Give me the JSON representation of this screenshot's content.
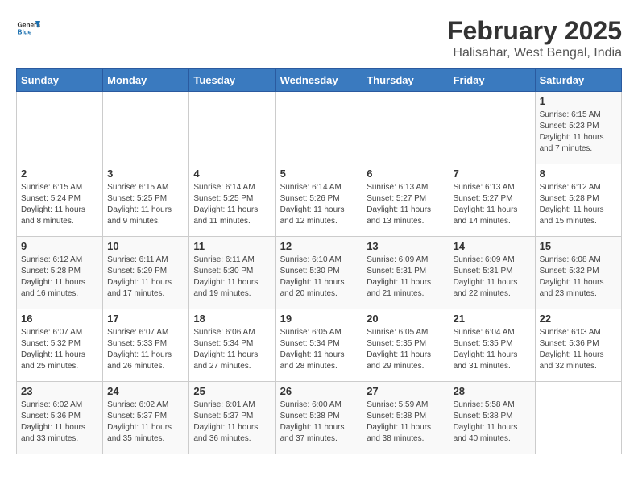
{
  "logo": {
    "text_general": "General",
    "text_blue": "Blue"
  },
  "title": {
    "month": "February 2025",
    "location": "Halisahar, West Bengal, India"
  },
  "headers": [
    "Sunday",
    "Monday",
    "Tuesday",
    "Wednesday",
    "Thursday",
    "Friday",
    "Saturday"
  ],
  "weeks": [
    [
      {
        "day": "",
        "info": ""
      },
      {
        "day": "",
        "info": ""
      },
      {
        "day": "",
        "info": ""
      },
      {
        "day": "",
        "info": ""
      },
      {
        "day": "",
        "info": ""
      },
      {
        "day": "",
        "info": ""
      },
      {
        "day": "1",
        "info": "Sunrise: 6:15 AM\nSunset: 5:23 PM\nDaylight: 11 hours\nand 7 minutes."
      }
    ],
    [
      {
        "day": "2",
        "info": "Sunrise: 6:15 AM\nSunset: 5:24 PM\nDaylight: 11 hours\nand 8 minutes."
      },
      {
        "day": "3",
        "info": "Sunrise: 6:15 AM\nSunset: 5:25 PM\nDaylight: 11 hours\nand 9 minutes."
      },
      {
        "day": "4",
        "info": "Sunrise: 6:14 AM\nSunset: 5:25 PM\nDaylight: 11 hours\nand 11 minutes."
      },
      {
        "day": "5",
        "info": "Sunrise: 6:14 AM\nSunset: 5:26 PM\nDaylight: 11 hours\nand 12 minutes."
      },
      {
        "day": "6",
        "info": "Sunrise: 6:13 AM\nSunset: 5:27 PM\nDaylight: 11 hours\nand 13 minutes."
      },
      {
        "day": "7",
        "info": "Sunrise: 6:13 AM\nSunset: 5:27 PM\nDaylight: 11 hours\nand 14 minutes."
      },
      {
        "day": "8",
        "info": "Sunrise: 6:12 AM\nSunset: 5:28 PM\nDaylight: 11 hours\nand 15 minutes."
      }
    ],
    [
      {
        "day": "9",
        "info": "Sunrise: 6:12 AM\nSunset: 5:28 PM\nDaylight: 11 hours\nand 16 minutes."
      },
      {
        "day": "10",
        "info": "Sunrise: 6:11 AM\nSunset: 5:29 PM\nDaylight: 11 hours\nand 17 minutes."
      },
      {
        "day": "11",
        "info": "Sunrise: 6:11 AM\nSunset: 5:30 PM\nDaylight: 11 hours\nand 19 minutes."
      },
      {
        "day": "12",
        "info": "Sunrise: 6:10 AM\nSunset: 5:30 PM\nDaylight: 11 hours\nand 20 minutes."
      },
      {
        "day": "13",
        "info": "Sunrise: 6:09 AM\nSunset: 5:31 PM\nDaylight: 11 hours\nand 21 minutes."
      },
      {
        "day": "14",
        "info": "Sunrise: 6:09 AM\nSunset: 5:31 PM\nDaylight: 11 hours\nand 22 minutes."
      },
      {
        "day": "15",
        "info": "Sunrise: 6:08 AM\nSunset: 5:32 PM\nDaylight: 11 hours\nand 23 minutes."
      }
    ],
    [
      {
        "day": "16",
        "info": "Sunrise: 6:07 AM\nSunset: 5:32 PM\nDaylight: 11 hours\nand 25 minutes."
      },
      {
        "day": "17",
        "info": "Sunrise: 6:07 AM\nSunset: 5:33 PM\nDaylight: 11 hours\nand 26 minutes."
      },
      {
        "day": "18",
        "info": "Sunrise: 6:06 AM\nSunset: 5:34 PM\nDaylight: 11 hours\nand 27 minutes."
      },
      {
        "day": "19",
        "info": "Sunrise: 6:05 AM\nSunset: 5:34 PM\nDaylight: 11 hours\nand 28 minutes."
      },
      {
        "day": "20",
        "info": "Sunrise: 6:05 AM\nSunset: 5:35 PM\nDaylight: 11 hours\nand 29 minutes."
      },
      {
        "day": "21",
        "info": "Sunrise: 6:04 AM\nSunset: 5:35 PM\nDaylight: 11 hours\nand 31 minutes."
      },
      {
        "day": "22",
        "info": "Sunrise: 6:03 AM\nSunset: 5:36 PM\nDaylight: 11 hours\nand 32 minutes."
      }
    ],
    [
      {
        "day": "23",
        "info": "Sunrise: 6:02 AM\nSunset: 5:36 PM\nDaylight: 11 hours\nand 33 minutes."
      },
      {
        "day": "24",
        "info": "Sunrise: 6:02 AM\nSunset: 5:37 PM\nDaylight: 11 hours\nand 35 minutes."
      },
      {
        "day": "25",
        "info": "Sunrise: 6:01 AM\nSunset: 5:37 PM\nDaylight: 11 hours\nand 36 minutes."
      },
      {
        "day": "26",
        "info": "Sunrise: 6:00 AM\nSunset: 5:38 PM\nDaylight: 11 hours\nand 37 minutes."
      },
      {
        "day": "27",
        "info": "Sunrise: 5:59 AM\nSunset: 5:38 PM\nDaylight: 11 hours\nand 38 minutes."
      },
      {
        "day": "28",
        "info": "Sunrise: 5:58 AM\nSunset: 5:38 PM\nDaylight: 11 hours\nand 40 minutes."
      },
      {
        "day": "",
        "info": ""
      }
    ]
  ]
}
